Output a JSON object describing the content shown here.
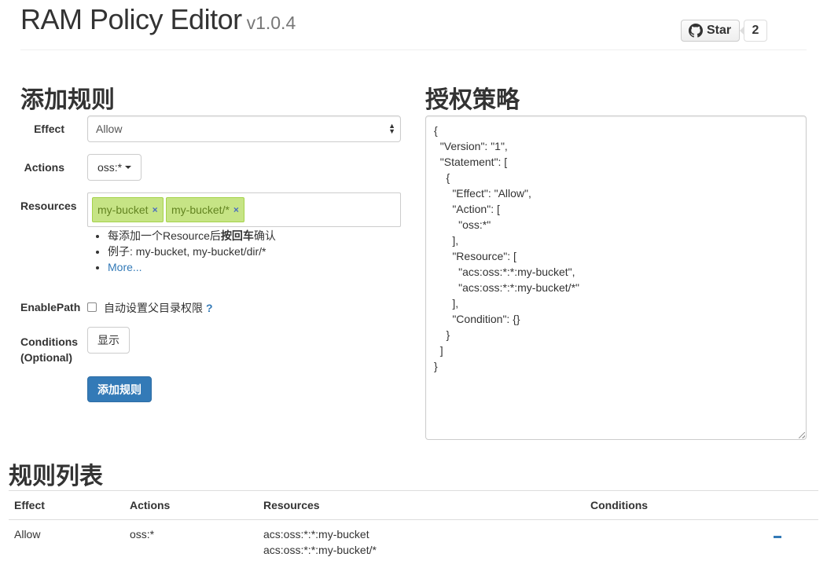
{
  "header": {
    "title": "RAM Policy Editor",
    "version": "v1.0.4",
    "star_label": "Star",
    "star_count": "2"
  },
  "add_rule": {
    "heading": "添加规则",
    "effect_label": "Effect",
    "effect_value": "Allow",
    "actions_label": "Actions",
    "actions_value": "oss:*",
    "resources_label": "Resources",
    "resource_tags": [
      "my-bucket",
      "my-bucket/*"
    ],
    "tag_remove_symbol": "×",
    "hints": {
      "item1_prefix": "每添加一个Resource后",
      "item1_bold": "按回车",
      "item1_suffix": "确认",
      "item2": "例子: my-bucket, my-bucket/dir/*",
      "more_link": "More..."
    },
    "enablepath_label": "EnablePath",
    "enablepath_text": "自动设置父目录权限",
    "enablepath_help": "?",
    "enablepath_checked": false,
    "conditions_label_line1": "Conditions",
    "conditions_label_line2": "(Optional)",
    "conditions_button": "显示",
    "submit_button": "添加规则"
  },
  "policy": {
    "heading": "授权策略",
    "json_text": "{\n  \"Version\": \"1\",\n  \"Statement\": [\n    {\n      \"Effect\": \"Allow\",\n      \"Action\": [\n        \"oss:*\"\n      ],\n      \"Resource\": [\n        \"acs:oss:*:*:my-bucket\",\n        \"acs:oss:*:*:my-bucket/*\"\n      ],\n      \"Condition\": {}\n    }\n  ]\n}"
  },
  "rule_list": {
    "heading": "规则列表",
    "columns": [
      "Effect",
      "Actions",
      "Resources",
      "Conditions"
    ],
    "rows": [
      {
        "effect": "Allow",
        "actions": "oss:*",
        "resources": [
          "acs:oss:*:*:my-bucket",
          "acs:oss:*:*:my-bucket/*"
        ],
        "conditions": ""
      }
    ]
  },
  "colors": {
    "primary": "#337ab7",
    "tag_bg": "#c6e485",
    "tag_text": "#638421"
  }
}
